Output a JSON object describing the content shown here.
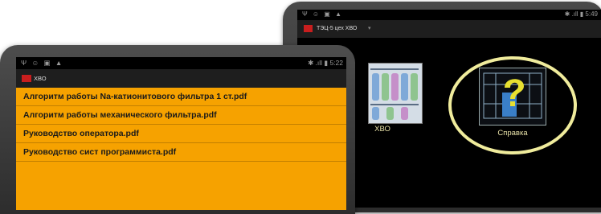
{
  "back_device": {
    "status": {
      "icons_left": "Ψ ☺ ▣ ▲",
      "right": "✱ .ıll ▮ 5:49"
    },
    "appbar": {
      "title": "ТЭЦ-5 цех ХВО"
    },
    "tiles": [
      {
        "label": "ХВО"
      },
      {
        "label": "Справка"
      }
    ]
  },
  "front_device": {
    "status": {
      "icons_left": "Ψ ☺ ▣ ▲",
      "right": "✱ .ıll ▮ 5:22"
    },
    "appbar": {
      "title": "ХВО"
    },
    "files": [
      "Алгоритм работы  Na-катионитового фильтра 1 ст.pdf",
      "Алгоритм работы механического  фильтра.pdf",
      "Руководство оператора.pdf",
      "Руководство сист программиста.pdf"
    ]
  },
  "colors": {
    "list_background": "#f6a200",
    "highlight_ring": "#f0ec9c",
    "tile_label": "#e9e2a8",
    "logo": "#c81e1e"
  }
}
